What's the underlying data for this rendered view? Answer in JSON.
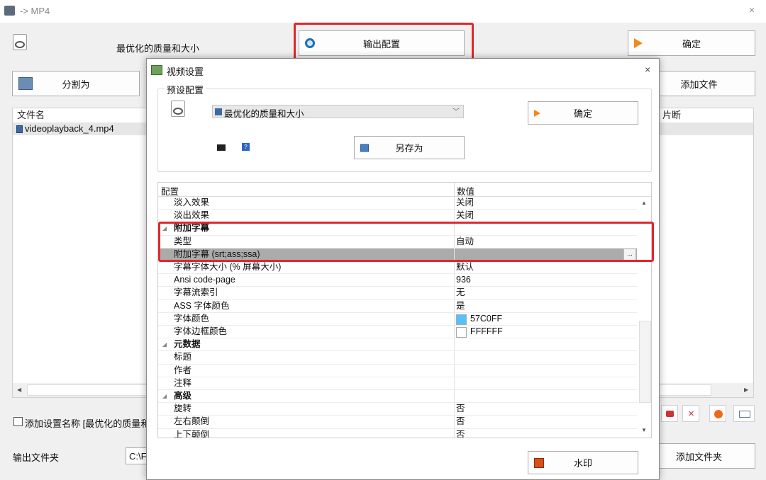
{
  "window": {
    "title": "-> MP4",
    "close": "×"
  },
  "main": {
    "preset_text": "最优化的质量和大小",
    "output_config_label": "输出配置",
    "ok_label": "确定",
    "split_label": "分割为",
    "add_file_label": "添加文件",
    "col_filename": "文件名",
    "col_segment": "片断",
    "files": [
      "videoplayback_4.mp4"
    ],
    "add_setting_name_label": "添加设置名称 [最优化的质量和大",
    "output_folder_label": "输出文件夹",
    "output_folder_value": "C:\\F",
    "add_folder_label": "添加文件夹"
  },
  "dialog": {
    "title": "视频设置",
    "close": "×",
    "preset_group_label": "预设配置",
    "preset_value": "最优化的质量和大小",
    "ok_label": "确定",
    "save_as_label": "另存为",
    "watermark_label": "水印",
    "grid": {
      "header_key": "配置",
      "header_value": "数值",
      "rows": [
        {
          "k": "淡入效果",
          "v": "关闭"
        },
        {
          "k": "淡出效果",
          "v": "关闭"
        },
        {
          "k": "附加字幕",
          "v": ""
        },
        {
          "k": "类型",
          "v": "自动"
        },
        {
          "k": "附加字幕 (srt;ass;ssa)",
          "v": ""
        },
        {
          "k": "字幕字体大小 (% 屏幕大小)",
          "v": "默认"
        },
        {
          "k": "Ansi code-page",
          "v": "936"
        },
        {
          "k": "字幕流索引",
          "v": "无"
        },
        {
          "k": "ASS 字体颜色",
          "v": "是"
        },
        {
          "k": "字体颜色",
          "v": "57C0FF"
        },
        {
          "k": "字体边框颜色",
          "v": "FFFFFF"
        },
        {
          "k": "元数据",
          "v": ""
        },
        {
          "k": "标题",
          "v": ""
        },
        {
          "k": "作者",
          "v": ""
        },
        {
          "k": "注释",
          "v": ""
        },
        {
          "k": "高级",
          "v": ""
        },
        {
          "k": "旋转",
          "v": "否"
        },
        {
          "k": "左右颠倒",
          "v": "否"
        },
        {
          "k": "上下颠倒",
          "v": "否"
        }
      ],
      "ellipsis": "..."
    }
  },
  "colors": {
    "accent": "#e3262b",
    "font_color": "#57C0FF",
    "border_color": "#FFFFFF",
    "selected_row": "#ababab"
  },
  "icons": [
    "app-icon",
    "mp4-icon",
    "settings-icon",
    "arrow-right-icon",
    "film-scissor-icon",
    "film-icon",
    "save-icon",
    "console-icon",
    "help-icon",
    "watermark-icon"
  ]
}
